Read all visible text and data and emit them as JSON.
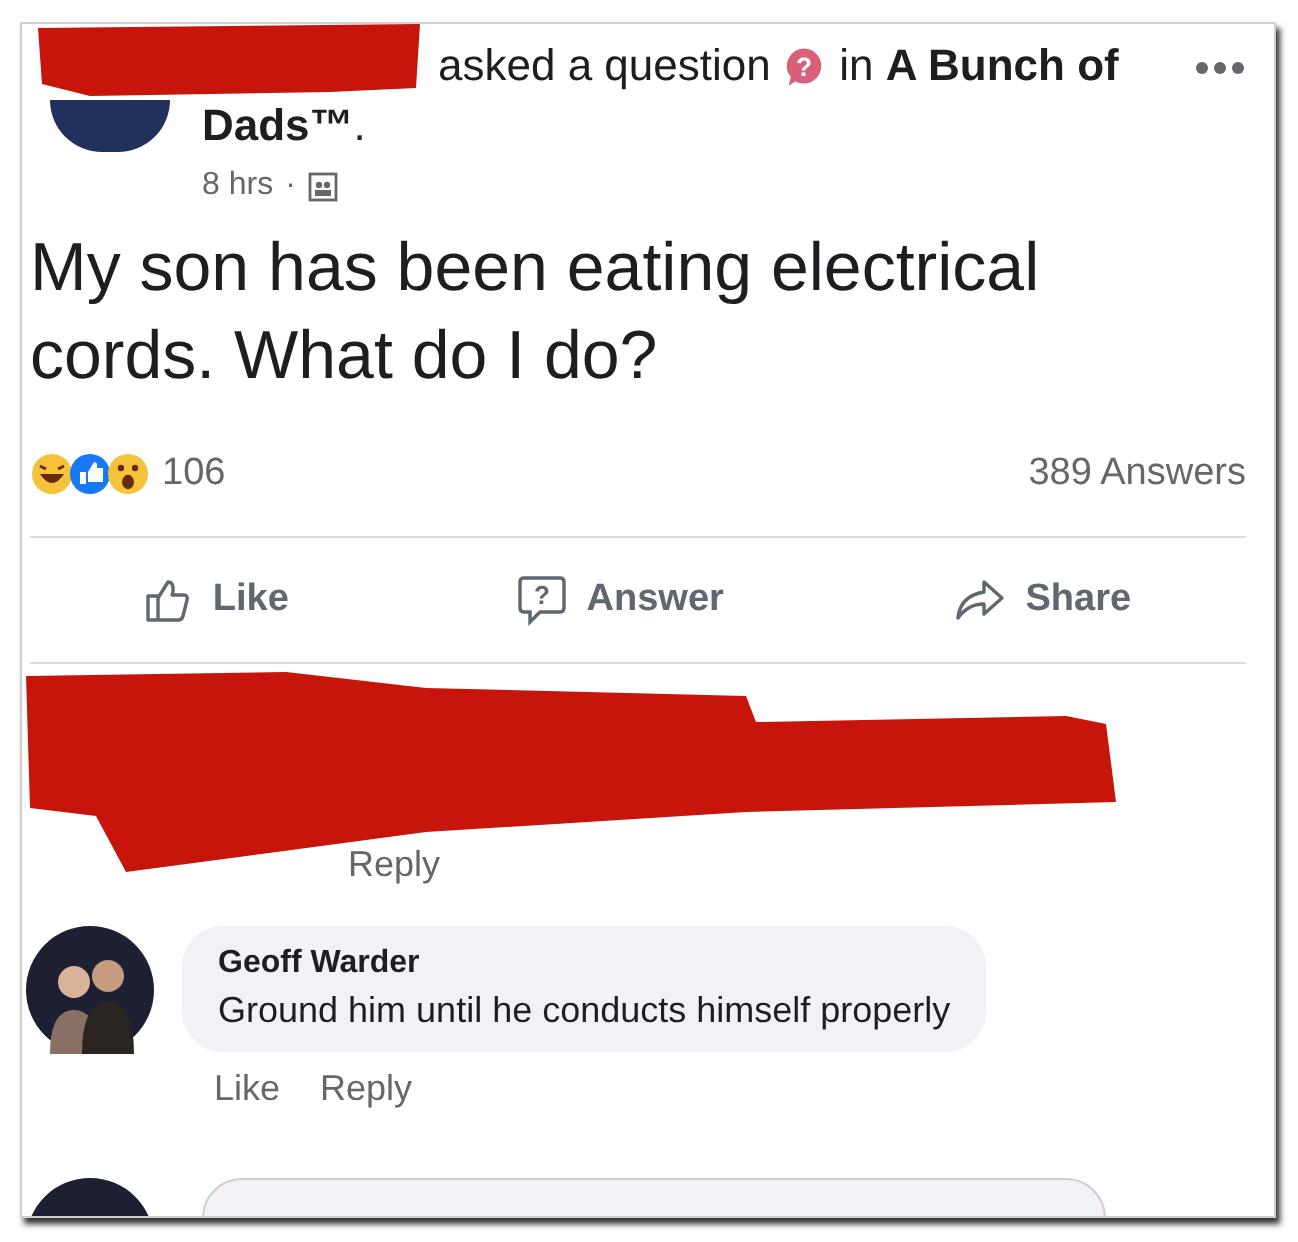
{
  "post": {
    "header": {
      "action": "asked a question",
      "group_text": "in **A Bunch of Dads™**.",
      "time": "8 hrs",
      "separator": "·",
      "icon_mark": "?"
    },
    "question": "My son has been eating electrical cords. What do I do?",
    "reactions": {
      "count": "106"
    },
    "answers_count": "389 Answers",
    "actions": [
      {
        "kind": "like",
        "label": "Like"
      },
      {
        "kind": "answer",
        "label": "Answer",
        "icon_mark": "?"
      },
      {
        "kind": "share",
        "label": "Share"
      }
    ]
  },
  "comments": [
    {
      "kind": "redacted",
      "actions": [
        "Reply"
      ]
    },
    {
      "kind": "comment",
      "author": "Geoff Warder",
      "text": "Ground him until he conducts himself properly",
      "actions": [
        "Like",
        "Reply"
      ]
    },
    {
      "kind": "cut_off"
    }
  ]
}
